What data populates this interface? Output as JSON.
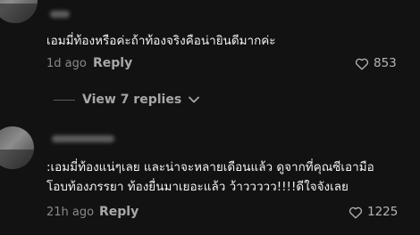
{
  "comments": [
    {
      "text_lines": [
        "เอมมี่ท้องหรือค่ะถ้าท้องจริงคือน่ายินดีมากค่ะ"
      ],
      "time": "1d ago",
      "reply_label": "Reply",
      "likes": "853"
    },
    {
      "text_lines": [
        ":เอมมี่ท้องแน่ๆเลย และน่าจะหลายเดือนแล้ว ดูจากที่คุณซีเอามือ",
        "โอบท้องภรรยา ท้องยื่นมาเยอะแล้ว ว้าววววว!!!!ดีใจจังเลย"
      ],
      "time": "21h ago",
      "reply_label": "Reply",
      "likes": "1225"
    }
  ],
  "view_replies": {
    "label": "View 7 replies",
    "chevron": "chevron-down-icon"
  },
  "colors": {
    "background": "#121212",
    "text": "#f2f2f2",
    "muted": "#8a8a8a"
  }
}
